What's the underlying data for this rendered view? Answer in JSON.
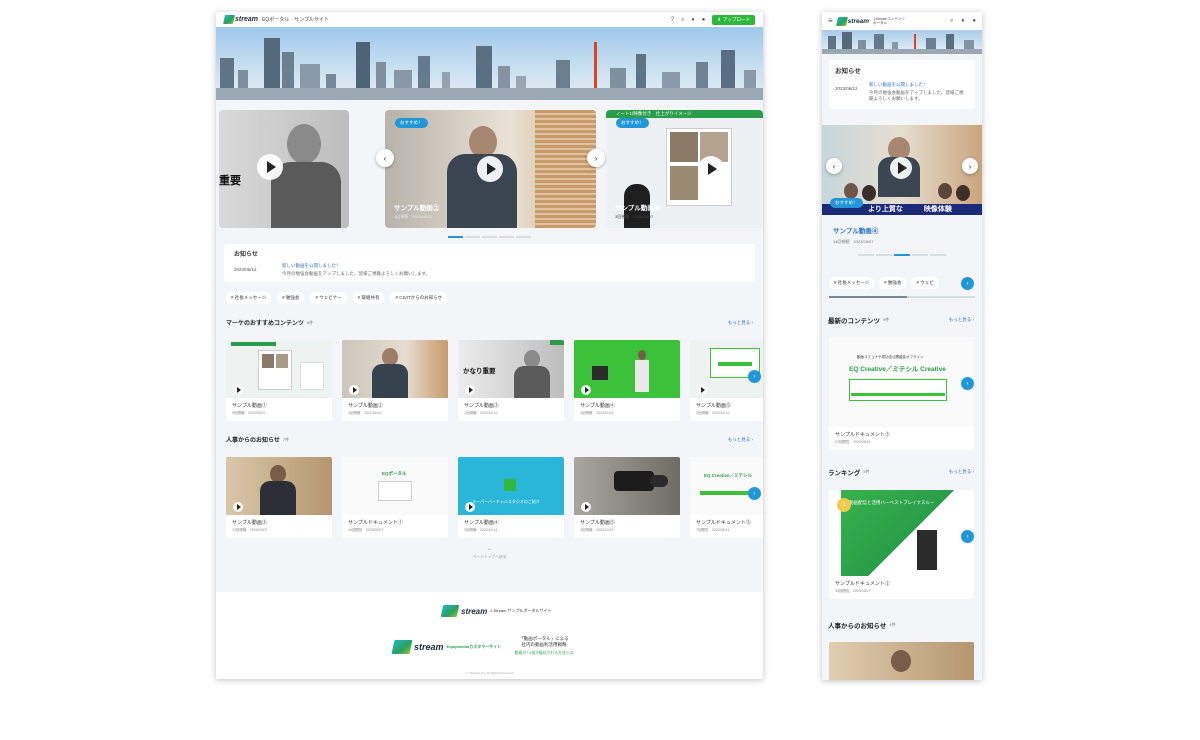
{
  "desktop": {
    "header": {
      "logo": "stream",
      "subtitle": "EQポータル　サンプルサイト",
      "upload_label": "アップロード"
    },
    "carousel": {
      "badge": "おすすめ！",
      "left_slide_text": "重要",
      "right_slide_heading": "ノート1/映像付き　仕上がりイメージ",
      "slides": [
        {
          "title": "サンプル動画②",
          "meta": "4回視聴　2021/06/31"
        },
        {
          "title": "サンプル動画⑤",
          "meta": "3回視聴　2023/03/07"
        }
      ]
    },
    "notice": {
      "heading": "お知らせ",
      "date": "2023/06/12",
      "link": "新しい動画を公開しました！",
      "text": "今月の勉強会動画をアップしました。皆様ご視聴よろしくお願いします。"
    },
    "tags": [
      "# 社長メッセージ",
      "# 勉強会",
      "# ウェビナー",
      "# 取組共有",
      "# CS/ITからのお知らせ"
    ],
    "section1": {
      "title": "マーケのおすすめコンテンツ",
      "count": "8件",
      "more": "もっと見る ›",
      "thumb3_label": "かなり重要",
      "cards": [
        {
          "title": "サンプル動画①",
          "meta": "9回視聴　2023/03/07"
        },
        {
          "title": "サンプル動画②",
          "meta": "4回視聴　2021/06/31"
        },
        {
          "title": "サンプル動画③",
          "meta": "1回視聴　2023/11/14"
        },
        {
          "title": "サンプル動画④",
          "meta": "4回視聴　2023/11/14"
        },
        {
          "title": "サンプル動画⑤",
          "meta": "3回視聴　2023/11/14"
        }
      ]
    },
    "section2": {
      "title": "人事からのお知らせ",
      "count": "7件",
      "more": "もっと見る ›",
      "thumb2_label": "EQポータル",
      "thumb3_label": "スーパーバーチャルスタジオのご紹介",
      "thumb5_label": "EQ Creative／ミテシル",
      "cards": [
        {
          "title": "サンプル動画③",
          "meta": "12回視聴　2023/03/07"
        },
        {
          "title": "サンプルドキュメント①",
          "meta": "16回閲覧　2023/03/07"
        },
        {
          "title": "サンプル動画④",
          "meta": "3回視聴　2023/11/14"
        },
        {
          "title": "サンプル動画⑤",
          "meta": "4回視聴　2023/12/19"
        },
        {
          "title": "サンプルドキュメント③",
          "meta": "7回閲覧　2023/06/14"
        }
      ]
    },
    "to_top": "ページトップへ戻る",
    "footer": {
      "logo_text": "stream",
      "sub": "J-Stream サンプルポータルサイト",
      "banner1_sub": "Equipmediaカスタマーサイト",
      "banner2_line1": "「動画ポータル」による",
      "banner2_line2": "社内の動画利活用戦略",
      "banner2_sub": "動画が7.5倍大幅化される方法とは",
      "copyright": "© J-Stream Inc. All Rights Reserved."
    }
  },
  "mobile": {
    "header": {
      "logo": "stream",
      "subtitle": "J-Streamコンテンツポータル"
    },
    "notice": {
      "heading": "お知らせ",
      "date": "2023/06/12",
      "link": "新しい動画を公開しました！",
      "text": "今月の勉強会動画をアップしました。皆様ご視聴よろしくお願いします。"
    },
    "slide": {
      "badge": "おすすめ！",
      "caption": "より上質な　　　映像体験",
      "title": "サンプル動画④",
      "meta": "14回視聴　2023/03/07"
    },
    "tags": [
      "# 社長メッセージ",
      "# 勉強会",
      "# ウェビ"
    ],
    "latest": {
      "title": "最新のコンテンツ",
      "count": "9件",
      "more": "もっと見る ›",
      "thumb_line1": "動画コミュナケ成功法公開盛会オフライン",
      "thumb_heading": "EQ Creative／ミテシル Creative",
      "card_title": "サンプルドキュメント③",
      "card_meta": "22回閲覧　2023/06/16"
    },
    "ranking": {
      "title": "ランキング",
      "count": "5件",
      "more": "もっと見る ›",
      "rank": "1",
      "thumb_text": "動画配信と活用ハーベストブレイクスルー",
      "card_title": "サンプルドキュメント②",
      "card_meta": "33回閲覧　2023/03/07"
    },
    "hr": {
      "title": "人事からのお知らせ",
      "count": "4件"
    }
  }
}
